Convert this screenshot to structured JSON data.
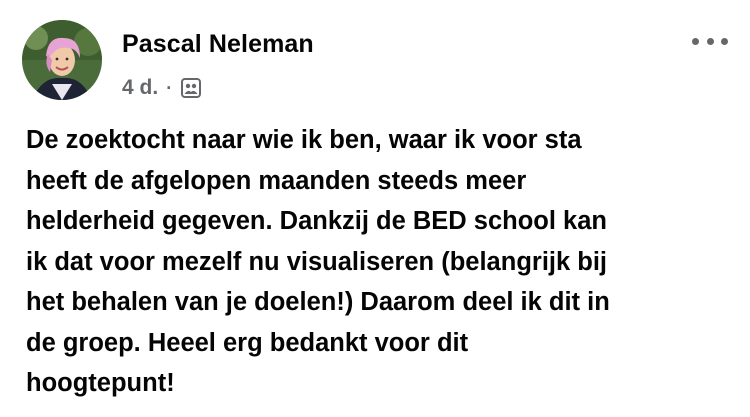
{
  "post": {
    "author": "Pascal Neleman",
    "timestamp": "4 d.",
    "separator": "·",
    "audience_icon": "group-members-icon",
    "more_icon": "more-options-icon",
    "text_lines": [
      "De zoektocht naar wie ik ben, waar ik voor sta",
      "heeft de afgelopen maanden steeds meer",
      "helderheid gegeven. Dankzij de BED school kan",
      "ik dat voor mezelf nu visualiseren (belangrijk bij",
      "het behalen van je doelen!) Daarom deel ik dit in",
      "de groep. Heeel erg bedankt voor dit",
      "hoogtepunt!"
    ]
  },
  "colors": {
    "text": "#050505",
    "secondary_text": "#65676b",
    "background": "#ffffff"
  }
}
